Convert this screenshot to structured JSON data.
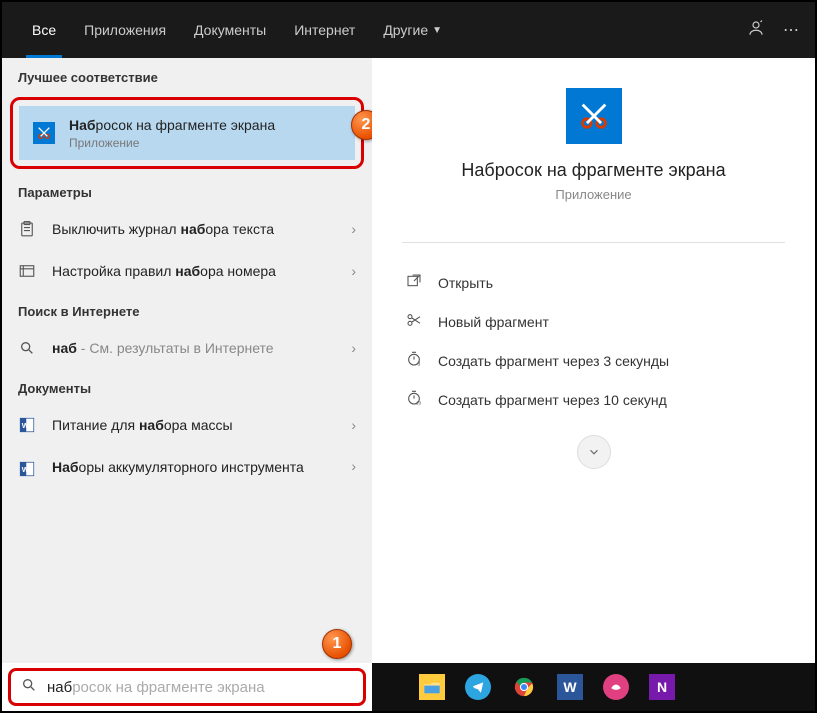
{
  "header": {
    "tabs": [
      "Все",
      "Приложения",
      "Документы",
      "Интернет",
      "Другие"
    ]
  },
  "left": {
    "best_match_header": "Лучшее соответствие",
    "best_match": {
      "title_bold": "Наб",
      "title_rest": "росок на фрагменте экрана",
      "subtitle": "Приложение"
    },
    "settings_header": "Параметры",
    "settings": [
      {
        "pre": "Выключить журнал ",
        "bold": "наб",
        "post": "ора текста"
      },
      {
        "pre": "Настройка правил ",
        "bold": "наб",
        "post": "ора номера"
      }
    ],
    "web_header": "Поиск в Интернете",
    "web": {
      "bold": "наб",
      "rest": " - См. результаты в Интернете"
    },
    "docs_header": "Документы",
    "docs": [
      {
        "pre": "Питание для ",
        "bold": "наб",
        "post": "ора массы"
      },
      {
        "boldpre": "Наб",
        "post": "оры аккумуляторного инструмента"
      }
    ]
  },
  "right": {
    "title": "Набросок на фрагменте экрана",
    "subtitle": "Приложение",
    "actions": [
      "Открыть",
      "Новый фрагмент",
      "Создать фрагмент через 3 секунды",
      "Создать фрагмент через 10 секунд"
    ]
  },
  "search": {
    "typed": "наб",
    "ghost": "росок на фрагменте экрана"
  },
  "markers": {
    "one": "1",
    "two": "2"
  }
}
